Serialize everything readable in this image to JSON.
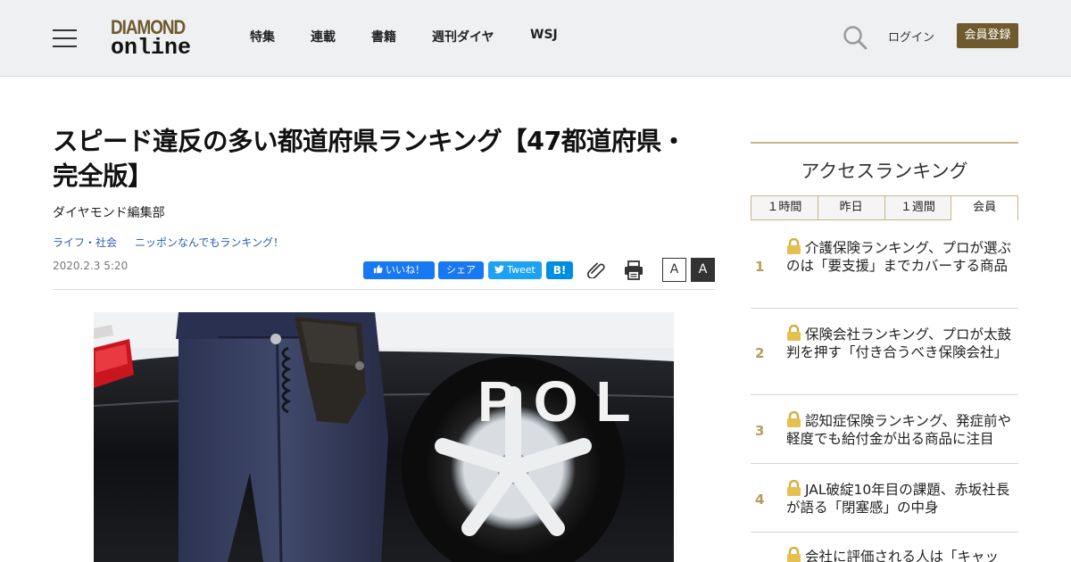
{
  "header": {
    "logo_top": "DIAMOND",
    "logo_bottom": "online",
    "nav": [
      "特集",
      "連載",
      "書籍",
      "週刊ダイヤ",
      "WSJ"
    ],
    "login": "ログイン",
    "register": "会員登録"
  },
  "article": {
    "title": "スピード違反の多い都道府県ランキング【47都道府県・完全版】",
    "author": "ダイヤモンド編集部",
    "categories": [
      "ライフ・社会",
      "ニッポンなんでもランキング！"
    ],
    "date": "2020.2.3 5:20",
    "share": {
      "like": "いいね！",
      "share": "シェア",
      "tweet": "Tweet",
      "hatena": "B!"
    },
    "font_small": "A",
    "font_large": "A",
    "photo_text": "POL"
  },
  "sidebar": {
    "title": "アクセスランキング",
    "tabs": [
      "１時間",
      "昨日",
      "１週間",
      "会員"
    ],
    "items": [
      {
        "rank": "1",
        "text": "介護保険ランキング、プロが選ぶのは「要支援」までカバーする商品"
      },
      {
        "rank": "2",
        "text": "保険会社ランキング、プロが太鼓判を押す「付き合うべき保険会社」"
      },
      {
        "rank": "3",
        "text": "認知症保険ランキング、発症前や軽度でも給付金が出る商品に注目"
      },
      {
        "rank": "4",
        "text": "JAL破綻10年目の課題、赤坂社長が語る「閉塞感」の中身"
      },
      {
        "rank": "5",
        "text": "会社に評価される人は「キャッ"
      }
    ]
  },
  "colors": {
    "brand": "#6e5a2d",
    "link": "#2a5db0",
    "rank_number": "#b99a5a",
    "facebook": "#1877f2",
    "twitter": "#1da1f2",
    "hatena": "#008fde"
  }
}
